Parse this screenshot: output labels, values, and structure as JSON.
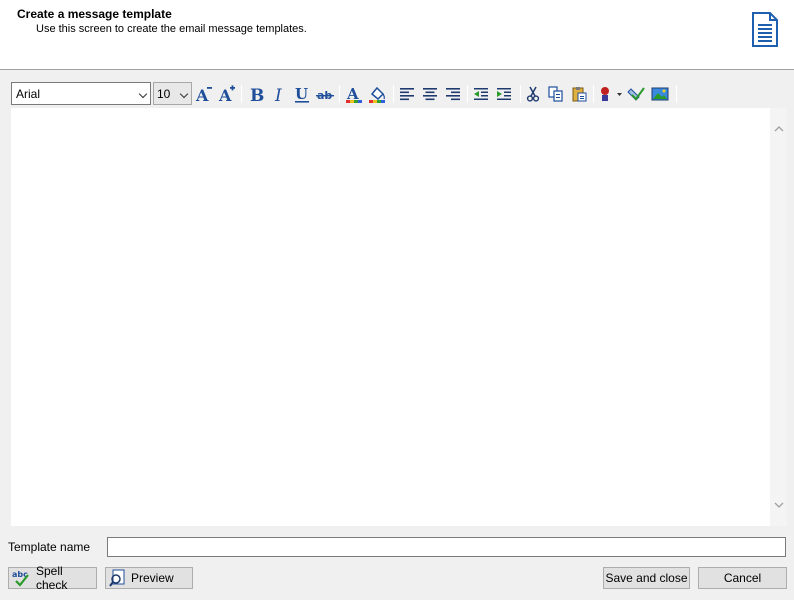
{
  "header": {
    "title": "Create a message template",
    "subtitle": "Use this screen to create the email message templates.",
    "icon": "document-icon"
  },
  "toolbar": {
    "font_family": "Arial",
    "font_size": "10",
    "buttons": [
      "grow-font-icon",
      "shrink-font-icon",
      "bold-icon",
      "italic-icon",
      "underline-icon",
      "strikethrough-icon",
      "font-color-icon",
      "highlight-icon",
      "align-left-icon",
      "align-center-icon",
      "align-right-icon",
      "outdent-icon",
      "indent-icon",
      "cut-icon",
      "copy-icon",
      "paste-icon",
      "insert-field-icon",
      "spell-check-icon",
      "insert-image-icon"
    ]
  },
  "editor": {
    "content": ""
  },
  "template_name": {
    "label": "Template name",
    "value": ""
  },
  "footer": {
    "spell_check": "Spell check",
    "preview": "Preview",
    "save_close": "Save and close",
    "cancel": "Cancel"
  },
  "colors": {
    "accent": "#1f4e9a",
    "background": "#f0f0f0"
  }
}
